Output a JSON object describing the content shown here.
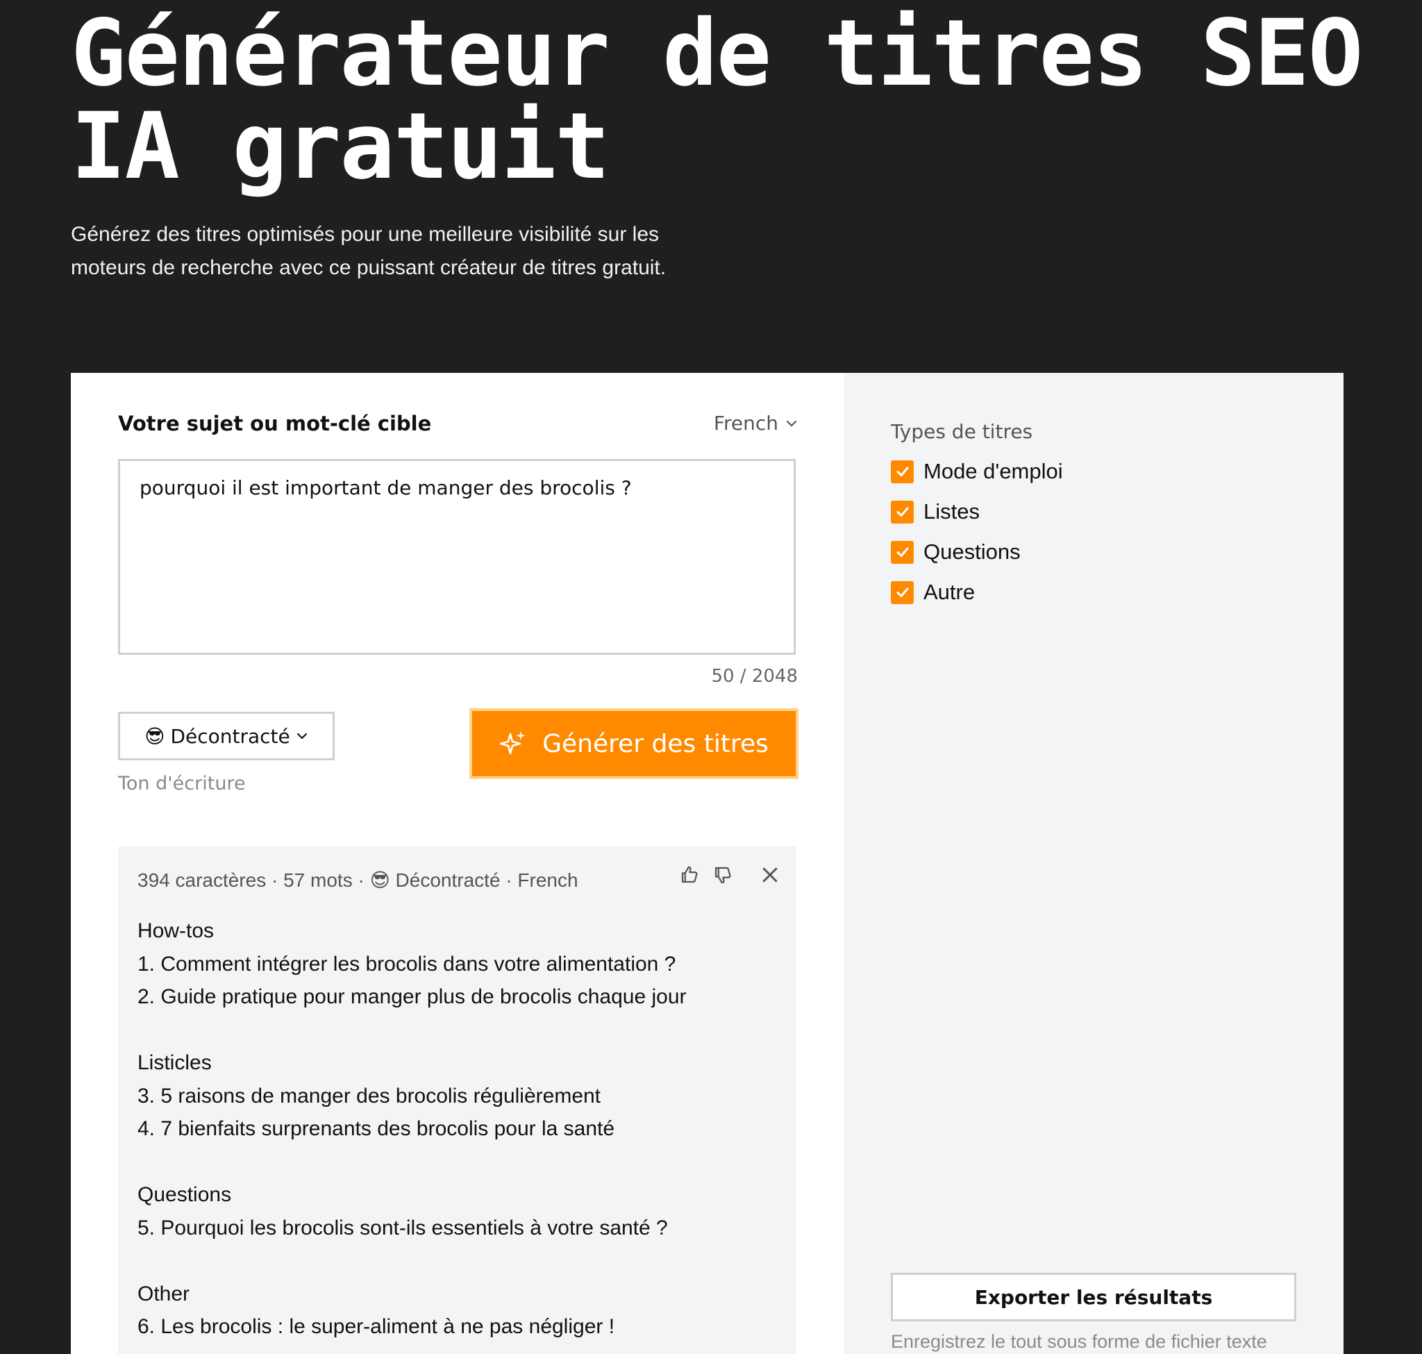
{
  "hero": {
    "title": "Générateur de titres SEO IA gratuit",
    "subtitle": "Générez des titres optimisés pour une meilleure visibilité sur les moteurs de recherche avec ce puissant créateur de titres gratuit."
  },
  "form": {
    "topic_label": "Votre sujet ou mot-clé cible",
    "language": "French",
    "topic_value": "pourquoi il est important de manger des brocolis ?",
    "char_count": "50 / 2048",
    "tone_emoji": "😎",
    "tone_value": "Décontracté",
    "tone_caption": "Ton d'écriture",
    "generate_label": "Générer des titres"
  },
  "results": {
    "meta": "394 caractères · 57 mots · 😎 Décontracté · French",
    "sections": [
      {
        "heading": "How-tos",
        "items": [
          "1. Comment intégrer les brocolis dans votre alimentation ?",
          "2. Guide pratique pour manger plus de brocolis chaque jour"
        ]
      },
      {
        "heading": "Listicles",
        "items": [
          "3. 5 raisons de manger des brocolis régulièrement",
          "4. 7 bienfaits surprenants des brocolis pour la santé"
        ]
      },
      {
        "heading": "Questions",
        "items": [
          "5. Pourquoi les brocolis sont-ils essentiels à votre santé ?"
        ]
      },
      {
        "heading": "Other",
        "items": [
          "6. Les brocolis : le super-aliment à ne pas négliger !"
        ]
      }
    ]
  },
  "sidebar": {
    "types_title": "Types de titres",
    "types": [
      {
        "label": "Mode d'emploi",
        "checked": true
      },
      {
        "label": "Listes",
        "checked": true
      },
      {
        "label": "Questions",
        "checked": true
      },
      {
        "label": "Autre",
        "checked": true
      }
    ],
    "export_label": "Exporter les résultats",
    "export_caption": "Enregistrez le tout sous forme de fichier texte"
  },
  "colors": {
    "accent": "#ff8a00",
    "background": "#1f1f1f",
    "panel": "#f3f4f6"
  },
  "icons": [
    "chevron-down-icon",
    "sparkles-icon",
    "thumbs-up-icon",
    "thumbs-down-icon",
    "close-icon",
    "check-icon"
  ]
}
